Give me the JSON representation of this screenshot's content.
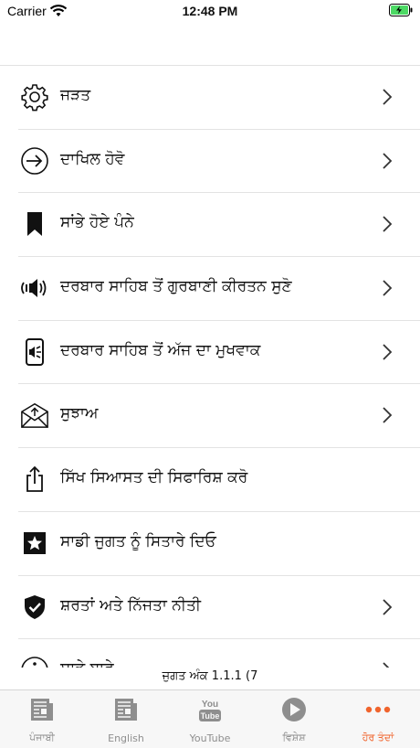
{
  "status_bar": {
    "carrier": "Carrier",
    "time": "12:48 PM"
  },
  "menu": {
    "items": [
      {
        "label": "ਜੜਤ",
        "icon": "gear-icon",
        "chevron": true
      },
      {
        "label": "ਦਾਖਿਲ ਹੋਵੋ",
        "icon": "login-arrow-icon",
        "chevron": true
      },
      {
        "label": "ਸਾਂਭੇ ਹੋਏ ਪੰਨੇ",
        "icon": "bookmark-icon",
        "chevron": true
      },
      {
        "label": "ਦਰਬਾਰ ਸਾਹਿਬ ਤੋਂ ਗੁਰਬਾਣੀ ਕੀਰਤਨ ਸੁਣੋ",
        "icon": "speaker-icon",
        "chevron": true
      },
      {
        "label": "ਦਰਬਾਰ ਸਾਹਿਬ ਤੋਂ ਅੱਜ ਦਾ ਮੁਖਵਾਕ",
        "icon": "phone-speaker-icon",
        "chevron": true
      },
      {
        "label": "ਸੁਝਾਅ",
        "icon": "mail-icon",
        "chevron": true
      },
      {
        "label": "ਸਿੱਖ ਸਿਆਸਤ ਦੀ ਸਿਫਾਰਿਸ਼ ਕਰੋ",
        "icon": "share-icon",
        "chevron": false
      },
      {
        "label": "ਸਾਡੀ ਜੁਗਤ ਨੂੰ ਸਿਤਾਰੇ ਦਿਓ",
        "icon": "star-icon",
        "chevron": false
      },
      {
        "label": "ਸ਼ਰਤਾਂ ਅਤੇ ਨਿੱਜਤਾ ਨੀਤੀ",
        "icon": "shield-check-icon",
        "chevron": true
      },
      {
        "label": "ਸਾਡੇ ਬਾਰੇ",
        "icon": "info-icon",
        "chevron": true
      }
    ]
  },
  "version_text": "ਜੁਗਤ ਅੰਕ 1.1.1 (7",
  "tab_bar": {
    "tabs": [
      {
        "label": "ਪੰਜਾਬੀ",
        "icon": "newspaper-icon"
      },
      {
        "label": "English",
        "icon": "newspaper-icon"
      },
      {
        "label": "YouTube",
        "icon": "youtube-icon"
      },
      {
        "label": "ਵਿਸ਼ੇਸ਼",
        "icon": "play-icon"
      },
      {
        "label": "ਹੋਰ ਤੰਦਾਂ",
        "icon": "more-dots-icon"
      }
    ]
  },
  "colors": {
    "accent": "#f0642d",
    "tab_inactive": "#8e8e8e",
    "battery_green": "#4cd964"
  }
}
